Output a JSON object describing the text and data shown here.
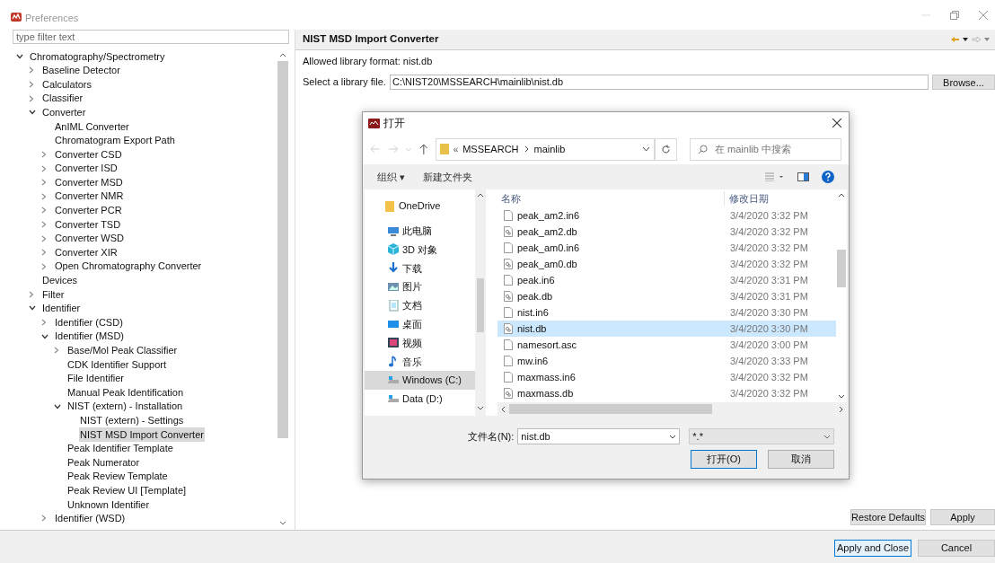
{
  "window": {
    "title": "Preferences"
  },
  "filter": {
    "placeholder": "type filter text"
  },
  "tree": [
    {
      "label": "Chromatography/Spectrometry",
      "expanded": true,
      "selected": false,
      "children": [
        {
          "label": "Baseline Detector",
          "expanded": false,
          "selected": false
        },
        {
          "label": "Calculators",
          "expanded": false,
          "selected": false
        },
        {
          "label": "Classifier",
          "expanded": false,
          "selected": false
        },
        {
          "label": "Converter",
          "expanded": true,
          "selected": false,
          "children": [
            {
              "label": "AnIML Converter",
              "selected": false
            },
            {
              "label": "Chromatogram Export Path",
              "selected": false
            },
            {
              "label": "Converter CSD",
              "expanded": false,
              "selected": false
            },
            {
              "label": "Converter ISD",
              "expanded": false,
              "selected": false
            },
            {
              "label": "Converter MSD",
              "expanded": false,
              "selected": false
            },
            {
              "label": "Converter NMR",
              "expanded": false,
              "selected": false
            },
            {
              "label": "Converter PCR",
              "expanded": false,
              "selected": false
            },
            {
              "label": "Converter TSD",
              "expanded": false,
              "selected": false
            },
            {
              "label": "Converter WSD",
              "expanded": false,
              "selected": false
            },
            {
              "label": "Converter XIR",
              "expanded": false,
              "selected": false
            },
            {
              "label": "Open Chromatography Converter",
              "expanded": false,
              "selected": false
            }
          ]
        },
        {
          "label": "Devices",
          "selected": false
        },
        {
          "label": "Filter",
          "expanded": false,
          "selected": false
        },
        {
          "label": "Identifier",
          "expanded": true,
          "selected": false,
          "children": [
            {
              "label": "Identifier (CSD)",
              "expanded": false,
              "selected": false
            },
            {
              "label": "Identifier (MSD)",
              "expanded": true,
              "selected": false,
              "children": [
                {
                  "label": "Base/Mol Peak Classifier",
                  "expanded": false,
                  "selected": false
                },
                {
                  "label": "CDK Identifier Support",
                  "selected": false
                },
                {
                  "label": "File Identifier",
                  "selected": false
                },
                {
                  "label": "Manual Peak Identification",
                  "selected": false
                },
                {
                  "label": "NIST (extern) - Installation",
                  "expanded": true,
                  "selected": false,
                  "children": [
                    {
                      "label": "NIST (extern) - Settings",
                      "selected": false
                    },
                    {
                      "label": "NIST MSD Import Converter",
                      "selected": true
                    }
                  ]
                },
                {
                  "label": "Peak Identifier Template",
                  "selected": false
                },
                {
                  "label": "Peak Numerator",
                  "selected": false
                },
                {
                  "label": "Peak Review Template",
                  "selected": false
                },
                {
                  "label": "Peak Review UI [Template]",
                  "selected": false
                },
                {
                  "label": "Unknown Identifier",
                  "selected": false
                }
              ]
            },
            {
              "label": "Identifier (WSD)",
              "expanded": false,
              "selected": false
            }
          ]
        }
      ]
    }
  ],
  "page": {
    "title": "NIST MSD Import Converter",
    "format_note": "Allowed library format: nist.db",
    "file_label": "Select a library file.",
    "file_value": "C:\\NIST20\\MSSEARCH\\mainlib\\nist.db",
    "browse": "Browse..."
  },
  "dialog": {
    "title": "打开",
    "path_prefix": "«",
    "path": [
      "MSSEARCH",
      "mainlib"
    ],
    "search": {
      "placeholder": "在 mainlib 中搜索"
    },
    "toolbar": [
      "组织 ▾",
      "新建文件夹"
    ],
    "nav": [
      {
        "label": "OneDrive",
        "kind": "cloud",
        "selected": false
      },
      {
        "label": "此电脑",
        "kind": "computer",
        "selected": false
      },
      {
        "label": "3D 对象",
        "kind": "cube",
        "selected": false
      },
      {
        "label": "下载",
        "kind": "download",
        "selected": false
      },
      {
        "label": "图片",
        "kind": "pictures",
        "selected": false
      },
      {
        "label": "文档",
        "kind": "documents",
        "selected": false
      },
      {
        "label": "桌面",
        "kind": "desktop",
        "selected": false
      },
      {
        "label": "视频",
        "kind": "videos",
        "selected": false
      },
      {
        "label": "音乐",
        "kind": "music",
        "selected": false
      },
      {
        "label": "Windows (C:)",
        "kind": "drive",
        "selected": true
      },
      {
        "label": "Data (D:)",
        "kind": "drive",
        "selected": false
      }
    ],
    "columns": [
      "名称",
      "修改日期"
    ],
    "files": [
      {
        "name": "peak_am2.in6",
        "kind": "plain",
        "date": "3/4/2020 3:32 PM",
        "selected": false
      },
      {
        "name": "peak_am2.db",
        "kind": "data",
        "date": "3/4/2020 3:32 PM",
        "selected": false
      },
      {
        "name": "peak_am0.in6",
        "kind": "plain",
        "date": "3/4/2020 3:32 PM",
        "selected": false
      },
      {
        "name": "peak_am0.db",
        "kind": "data",
        "date": "3/4/2020 3:32 PM",
        "selected": false
      },
      {
        "name": "peak.in6",
        "kind": "plain",
        "date": "3/4/2020 3:31 PM",
        "selected": false
      },
      {
        "name": "peak.db",
        "kind": "data",
        "date": "3/4/2020 3:31 PM",
        "selected": false
      },
      {
        "name": "nist.in6",
        "kind": "plain",
        "date": "3/4/2020 3:30 PM",
        "selected": false
      },
      {
        "name": "nist.db",
        "kind": "data",
        "date": "3/4/2020 3:30 PM",
        "selected": true
      },
      {
        "name": "namesort.asc",
        "kind": "plain",
        "date": "3/4/2020 3:00 PM",
        "selected": false
      },
      {
        "name": "mw.in6",
        "kind": "plain",
        "date": "3/4/2020 3:33 PM",
        "selected": false
      },
      {
        "name": "maxmass.in6",
        "kind": "plain",
        "date": "3/4/2020 3:32 PM",
        "selected": false
      },
      {
        "name": "maxmass.db",
        "kind": "data",
        "date": "3/4/2020 3:32 PM",
        "selected": false
      }
    ],
    "filename_label": "文件名(N):",
    "filename": "nist.db",
    "filetype": "*.*",
    "open": "打开(O)",
    "cancel": "取消"
  },
  "buttons": {
    "restore": "Restore Defaults",
    "apply": "Apply",
    "apply_close": "Apply and Close",
    "cancel": "Cancel"
  }
}
